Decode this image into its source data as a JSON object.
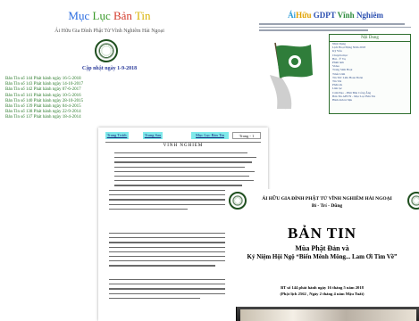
{
  "left": {
    "title_parts": [
      "Mục",
      "Lục",
      "Bản",
      "Tin"
    ],
    "title_colors": [
      "#2b6de0",
      "#3a9a2a",
      "#d23a2a",
      "#d8b200"
    ],
    "subtitle": "Ái Hữu Gia Đình Phật Tử Vĩnh Nghiêm Hải Ngoại",
    "updated": "Cập nhật ngày 1-9-2018",
    "issues": [
      "Bản Tin số 144 Phát hành ngày 16-5-2018",
      "Bản Tin số 143 Phát hành ngày 14-10-2017",
      "Bản Tin số 142 Phát hành ngày 07-6-2017",
      "Bản Tin số 141 Phát hành ngày 10-5-2016",
      "Bản Tin số 140 Phát hành ngày 28-10-2015",
      "Bản Tin số 139 Phát hành ngày 04-4-2015",
      "Bản Tin số 138 Phát hành ngày 22-9-2014",
      "Bản Tin số 137 Phát hành ngày 18-4-2014"
    ]
  },
  "right": {
    "title_a": "Ái",
    "title_b": "Hữu",
    "title_c": " GDPT ",
    "title_d": "Vĩnh",
    "title_e": " Nghiêm",
    "menu_header": "Nội Dung",
    "menu_items": [
      "Nhật Dụng",
      "Lịch Hoạt Động Năm 2018",
      "Kỷ Yếu",
      "Chuyên mục",
      "Bài - Ý Vụ",
      "Phim ảnh",
      "Video",
      "Trang Sinh Hoạt",
      "Triển Lãm",
      "Tin Tức Liên Hoan Đoàn",
      "Tin Vui",
      "Phân ưu",
      "Liên lạc",
      "Cám Đạo - Phật Đản Cổng Ăng",
      "Bản Tin AHVN - Mục Lục Bản Tin",
      "Hình ảnh tư liệu"
    ],
    "colors": {
      "ai": "#2b9bd6",
      "huu": "#e0a100",
      "gdpt": "#2b4fb0",
      "vinh": "#2a8a3a",
      "nghiem": "#2b4fb0"
    }
  },
  "center": {
    "tabs": [
      "Trang Trước",
      "Trang Sau",
      "Mục Lục Bản Tin",
      "Trang - 1"
    ],
    "heading": "VINH NGHIEM",
    "line_count": 12
  },
  "cover": {
    "org": "ÁI HỮU GIA ĐÌNH PHẬT TỬ VĨNH NGHIÊM HẢI NGOẠI",
    "motto": "Bi - Trí - Dũng",
    "big_title": "BẢN TIN",
    "subtitle1": "Mùa Phật Đản và",
    "subtitle2": "Kỷ Niệm Hội Ngộ “Biển Mênh Mông... Lam Ơi Tìm Về”",
    "issue_line": "BT số 144 phát hành ngày 16 tháng 5 năm 2018",
    "lunar_line": "(Phật lịch 2562 , Ngày 2 tháng 4 năm  Mậu Tuất)"
  }
}
